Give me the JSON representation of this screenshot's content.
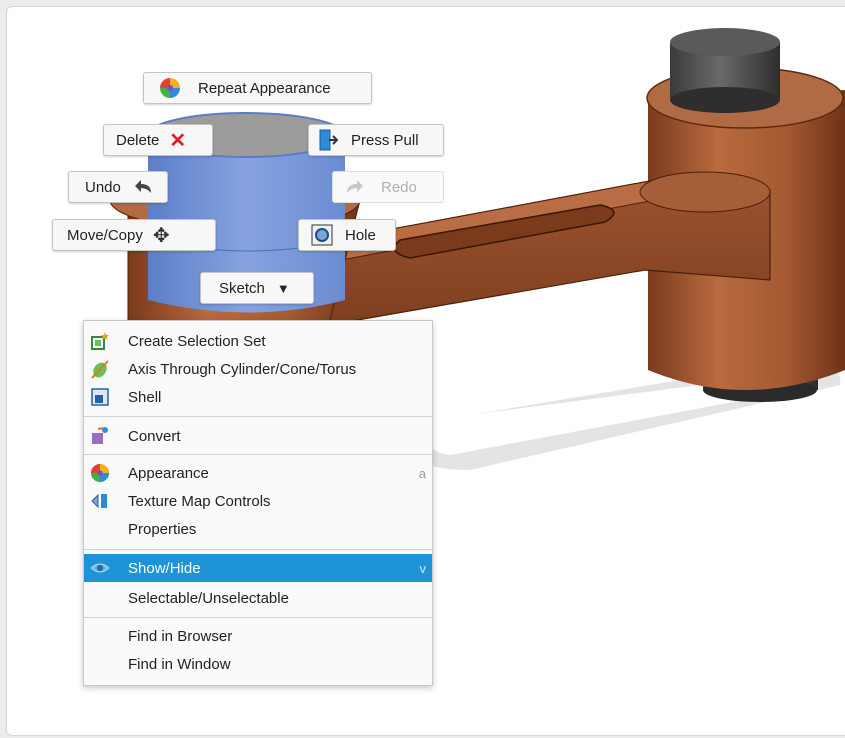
{
  "marking_menu": {
    "repeat_appearance": "Repeat Appearance",
    "delete": "Delete",
    "press_pull": "Press Pull",
    "undo": "Undo",
    "redo": "Redo",
    "move_copy": "Move/Copy",
    "hole": "Hole",
    "sketch": "Sketch"
  },
  "context_menu": {
    "items": [
      {
        "label": "Create Selection Set",
        "icon": "selection-set-icon"
      },
      {
        "label": "Axis Through Cylinder/Cone/Torus",
        "icon": "axis-icon"
      },
      {
        "label": "Shell",
        "icon": "shell-icon"
      },
      {
        "label": "Convert",
        "icon": "convert-icon"
      },
      {
        "label": "Appearance",
        "icon": "appearance-icon",
        "shortcut": "a"
      },
      {
        "label": "Texture Map Controls",
        "icon": "texture-map-icon"
      },
      {
        "label": "Properties"
      },
      {
        "label": "Show/Hide",
        "icon": "eye-icon",
        "shortcut": "v",
        "highlighted": true
      },
      {
        "label": "Selectable/Unselectable"
      },
      {
        "label": "Find in Browser"
      },
      {
        "label": "Find in Window"
      }
    ]
  },
  "colors": {
    "highlight": "#1e93d6",
    "part_copper": "#a65a32",
    "selected_face": "#6f93d6",
    "pin_steel": "#4a4a4a"
  }
}
